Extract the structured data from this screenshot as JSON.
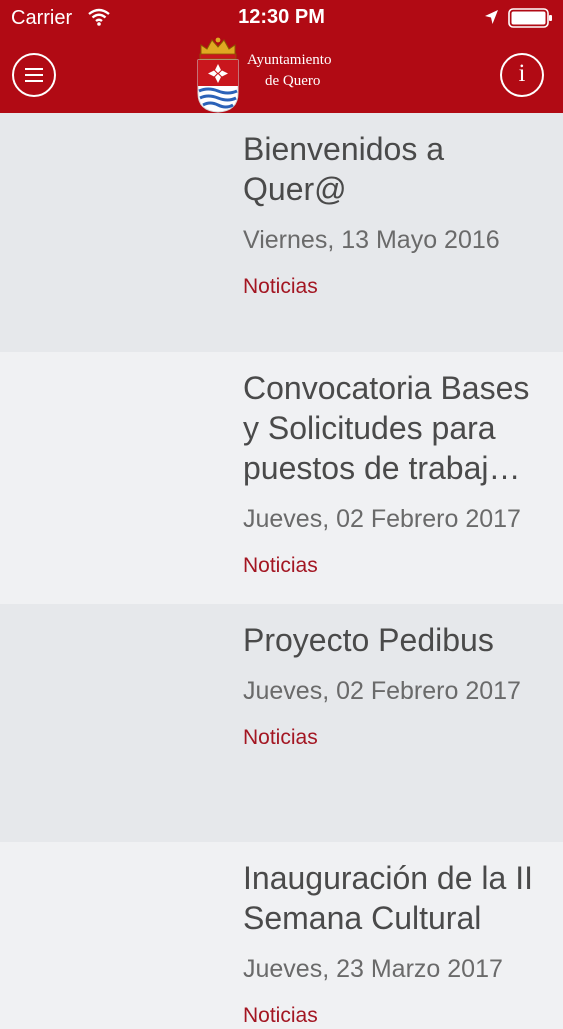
{
  "status_bar": {
    "carrier": "Carrier",
    "time": "12:30 PM"
  },
  "header": {
    "logo_line1": "Ayuntamiento",
    "logo_line2": "de Quero",
    "info_label": "i",
    "background_color": "#b10a14"
  },
  "icons": {
    "menu": "hamburger-menu-icon",
    "info": "info-icon",
    "wifi": "wifi-icon",
    "location": "location-arrow-icon",
    "battery": "battery-icon",
    "crest": "coat-of-arms-icon"
  },
  "news": [
    {
      "title": "Bienvenidos a Quer@",
      "date": "Viernes, 13 Mayo 2016",
      "category": "Noticias"
    },
    {
      "title": "Convocatoria Bases y Solicitudes para puestos de trabaj…",
      "date": "Jueves, 02 Febrero 2017",
      "category": "Noticias"
    },
    {
      "title": "Proyecto Pedibus",
      "date": "Jueves, 02 Febrero 2017",
      "category": "Noticias"
    },
    {
      "title": "Inauguración de la II Semana Cultural",
      "date": "Jueves, 23 Marzo 2017",
      "category": "Noticias"
    }
  ],
  "colors": {
    "category_accent": "#a31622",
    "row_dark": "#e6e8eb",
    "row_light": "#f0f1f3"
  }
}
